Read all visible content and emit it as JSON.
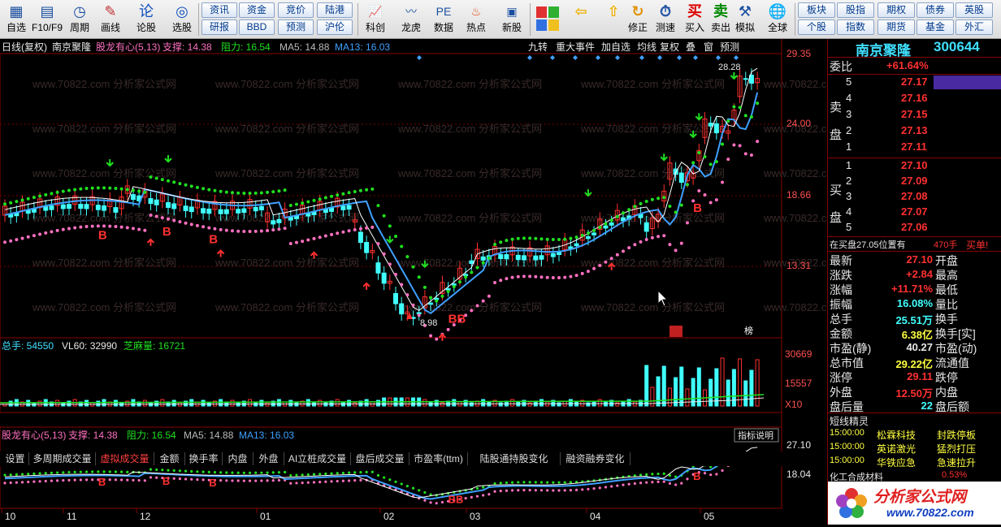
{
  "toolbar": {
    "items": [
      {
        "icon": "window-icon",
        "label": "自选"
      },
      {
        "icon": "f10-icon",
        "label": "F10/F9"
      },
      {
        "icon": "clock-icon",
        "label": "周期"
      },
      {
        "icon": "pen-icon",
        "label": "画线"
      },
      {
        "icon": "lun-icon",
        "label": "论股"
      },
      {
        "icon": "target-icon",
        "label": "选股"
      }
    ],
    "pills_a": [
      "资讯",
      "资金",
      "竞价",
      "陆港",
      "研报",
      "BBD",
      "预测",
      "沪伦"
    ],
    "items2": [
      {
        "icon": "chart-icon",
        "label": "科创"
      },
      {
        "icon": "dragon-icon",
        "label": "龙虎"
      },
      {
        "icon": "pe-icon",
        "label": "数据"
      },
      {
        "icon": "hot-icon",
        "label": "热点"
      },
      {
        "icon": "new-icon",
        "label": "新股"
      }
    ],
    "items3": [
      {
        "icon": "arrow-left-icon",
        "label": ""
      },
      {
        "icon": "arrow-up-icon",
        "label": ""
      },
      {
        "icon": "refresh-icon",
        "label": "修正"
      },
      {
        "icon": "stopwatch-icon",
        "label": "测速"
      },
      {
        "icon": "buy-icon",
        "label": "买入"
      },
      {
        "icon": "sell-icon",
        "label": "卖出"
      },
      {
        "icon": "hammer-icon",
        "label": "模拟"
      },
      {
        "icon": "globe-icon",
        "label": "全球"
      }
    ],
    "pills_b": [
      "板块",
      "股指",
      "期权",
      "债券",
      "英股",
      "个股",
      "指数",
      "期货",
      "基金",
      "外汇"
    ]
  },
  "chart": {
    "header": "日线(复权)",
    "stock_name": "南京聚隆",
    "indicator": "股龙有心(5,13)",
    "support": "支撑: 14.38",
    "resist": "阻力: 16.54",
    "ma5": "MA5: 14.88",
    "ma13": "MA13: 16.03",
    "buttons": [
      "九转",
      "重大事件",
      "加自选",
      "均线",
      "复权",
      "叠",
      "窗",
      "预测"
    ],
    "price_ticks": [
      "29.35",
      "24.00",
      "18.66",
      "13.31"
    ],
    "high_label": "28.28",
    "low_label": "8.98",
    "watermark": "www.70822.com 分析家公式网",
    "markers": [
      "涨",
      "榜"
    ],
    "vol_header": {
      "total": "总手: 54550",
      "vl60": "VL60: 32990",
      "sesame": "芝麻量: 16721"
    },
    "vol_ticks": [
      "30669",
      "15557",
      "X10"
    ],
    "tabs": [
      "设置",
      "多周期成交量",
      "虚拟成交量",
      "金额",
      "换手率",
      "内盘",
      "外盘",
      "AI立桩成交量",
      "盘后成交量",
      "市盈率(ttm)",
      "陆股通持股变化",
      "融资融券变化"
    ],
    "active_tab": "虚拟成交量",
    "sub_header": {
      "indicator": "股龙有心(5,13)",
      "support": "支撑: 14.38",
      "resist": "阻力: 16.54",
      "ma5": "MA5: 14.88",
      "ma13": "MA13: 16.03"
    },
    "sub_ticks": [
      "27.10",
      "18.04"
    ],
    "help_button": "指标说明",
    "months": [
      "10",
      "11",
      "12",
      "01",
      "02",
      "03",
      "04",
      "05"
    ]
  },
  "quote": {
    "title": "南京聚隆",
    "code": "300644",
    "ratio_label": "委比",
    "ratio_value": "+61.64%",
    "sell_label": "卖盘",
    "buy_label": "买盘",
    "sells": [
      {
        "n": "5",
        "p": "27.17"
      },
      {
        "n": "4",
        "p": "27.16"
      },
      {
        "n": "3",
        "p": "27.15"
      },
      {
        "n": "2",
        "p": "27.13"
      },
      {
        "n": "1",
        "p": "27.11"
      }
    ],
    "buys": [
      {
        "n": "1",
        "p": "27.10"
      },
      {
        "n": "2",
        "p": "27.09"
      },
      {
        "n": "3",
        "p": "27.08"
      },
      {
        "n": "4",
        "p": "27.07"
      },
      {
        "n": "5",
        "p": "27.06"
      }
    ],
    "note": "在买盘27.05位置有",
    "note_qty": "470手",
    "note_buy": "买单!",
    "stats": [
      {
        "l": "最新",
        "v": "27.10",
        "r": "开盘"
      },
      {
        "l": "涨跌",
        "v": "+2.84",
        "r": "最高"
      },
      {
        "l": "涨幅",
        "v": "+11.71%",
        "r": "最低"
      },
      {
        "l": "振幅",
        "v": "16.08%",
        "r": "量比"
      },
      {
        "l": "总手",
        "v": "25.51万",
        "r": "换手"
      },
      {
        "l": "金额",
        "v": "6.38亿",
        "r": "换手[实]"
      },
      {
        "l": "市盈(静)",
        "v": "40.27",
        "r": "市盈(动)"
      },
      {
        "l": "总市值",
        "v": "29.22亿",
        "r": "流通值"
      },
      {
        "l": "涨停",
        "v": "29.11",
        "r": "跌停"
      },
      {
        "l": "外盘",
        "v": "12.50万",
        "r": "内盘"
      },
      {
        "l": "盘后量",
        "v": "22",
        "r": "盘后额"
      }
    ],
    "short_title": "短线精灵",
    "short": [
      {
        "time": "15:00:00",
        "name": "松霖科技",
        "event": "封跌停板"
      },
      {
        "time": "15:00:00",
        "name": "英诺激光",
        "event": "猛烈打压"
      },
      {
        "time": "15:00:00",
        "name": "华铁应急",
        "event": "急速拉升"
      }
    ],
    "short_partial": "化工合成材料",
    "short_partial_pct": "0.53%",
    "logo_text": "分析家公式网",
    "logo_url": "www.70822.com"
  },
  "colors": {
    "up": "#ff3030",
    "down": "#40ffff",
    "ma5": "#ffffff",
    "ma13": "#3fa0ff",
    "support": "#ff70c0",
    "resist": "#20e020",
    "label": "#ff8080"
  }
}
